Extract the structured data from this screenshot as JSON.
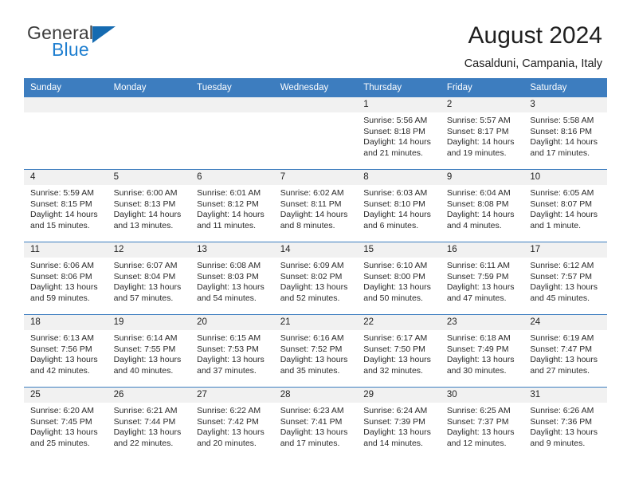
{
  "brand": {
    "general": "General",
    "blue": "Blue",
    "accent_color": "#1f7fd0",
    "flag_color": "#156bb1"
  },
  "header": {
    "title": "August 2024",
    "subtitle": "Casalduni, Campania, Italy"
  },
  "calendar": {
    "header_bg": "#3d7dbf",
    "daynum_bg": "#f1f1f1",
    "weekdays": [
      "Sunday",
      "Monday",
      "Tuesday",
      "Wednesday",
      "Thursday",
      "Friday",
      "Saturday"
    ],
    "weeks": [
      [
        {
          "day": "",
          "empty": true
        },
        {
          "day": "",
          "empty": true
        },
        {
          "day": "",
          "empty": true
        },
        {
          "day": "",
          "empty": true
        },
        {
          "day": "1",
          "sunrise": "Sunrise: 5:56 AM",
          "sunset": "Sunset: 8:18 PM",
          "daylight": "Daylight: 14 hours and 21 minutes."
        },
        {
          "day": "2",
          "sunrise": "Sunrise: 5:57 AM",
          "sunset": "Sunset: 8:17 PM",
          "daylight": "Daylight: 14 hours and 19 minutes."
        },
        {
          "day": "3",
          "sunrise": "Sunrise: 5:58 AM",
          "sunset": "Sunset: 8:16 PM",
          "daylight": "Daylight: 14 hours and 17 minutes."
        }
      ],
      [
        {
          "day": "4",
          "sunrise": "Sunrise: 5:59 AM",
          "sunset": "Sunset: 8:15 PM",
          "daylight": "Daylight: 14 hours and 15 minutes."
        },
        {
          "day": "5",
          "sunrise": "Sunrise: 6:00 AM",
          "sunset": "Sunset: 8:13 PM",
          "daylight": "Daylight: 14 hours and 13 minutes."
        },
        {
          "day": "6",
          "sunrise": "Sunrise: 6:01 AM",
          "sunset": "Sunset: 8:12 PM",
          "daylight": "Daylight: 14 hours and 11 minutes."
        },
        {
          "day": "7",
          "sunrise": "Sunrise: 6:02 AM",
          "sunset": "Sunset: 8:11 PM",
          "daylight": "Daylight: 14 hours and 8 minutes."
        },
        {
          "day": "8",
          "sunrise": "Sunrise: 6:03 AM",
          "sunset": "Sunset: 8:10 PM",
          "daylight": "Daylight: 14 hours and 6 minutes."
        },
        {
          "day": "9",
          "sunrise": "Sunrise: 6:04 AM",
          "sunset": "Sunset: 8:08 PM",
          "daylight": "Daylight: 14 hours and 4 minutes."
        },
        {
          "day": "10",
          "sunrise": "Sunrise: 6:05 AM",
          "sunset": "Sunset: 8:07 PM",
          "daylight": "Daylight: 14 hours and 1 minute."
        }
      ],
      [
        {
          "day": "11",
          "sunrise": "Sunrise: 6:06 AM",
          "sunset": "Sunset: 8:06 PM",
          "daylight": "Daylight: 13 hours and 59 minutes."
        },
        {
          "day": "12",
          "sunrise": "Sunrise: 6:07 AM",
          "sunset": "Sunset: 8:04 PM",
          "daylight": "Daylight: 13 hours and 57 minutes."
        },
        {
          "day": "13",
          "sunrise": "Sunrise: 6:08 AM",
          "sunset": "Sunset: 8:03 PM",
          "daylight": "Daylight: 13 hours and 54 minutes."
        },
        {
          "day": "14",
          "sunrise": "Sunrise: 6:09 AM",
          "sunset": "Sunset: 8:02 PM",
          "daylight": "Daylight: 13 hours and 52 minutes."
        },
        {
          "day": "15",
          "sunrise": "Sunrise: 6:10 AM",
          "sunset": "Sunset: 8:00 PM",
          "daylight": "Daylight: 13 hours and 50 minutes."
        },
        {
          "day": "16",
          "sunrise": "Sunrise: 6:11 AM",
          "sunset": "Sunset: 7:59 PM",
          "daylight": "Daylight: 13 hours and 47 minutes."
        },
        {
          "day": "17",
          "sunrise": "Sunrise: 6:12 AM",
          "sunset": "Sunset: 7:57 PM",
          "daylight": "Daylight: 13 hours and 45 minutes."
        }
      ],
      [
        {
          "day": "18",
          "sunrise": "Sunrise: 6:13 AM",
          "sunset": "Sunset: 7:56 PM",
          "daylight": "Daylight: 13 hours and 42 minutes."
        },
        {
          "day": "19",
          "sunrise": "Sunrise: 6:14 AM",
          "sunset": "Sunset: 7:55 PM",
          "daylight": "Daylight: 13 hours and 40 minutes."
        },
        {
          "day": "20",
          "sunrise": "Sunrise: 6:15 AM",
          "sunset": "Sunset: 7:53 PM",
          "daylight": "Daylight: 13 hours and 37 minutes."
        },
        {
          "day": "21",
          "sunrise": "Sunrise: 6:16 AM",
          "sunset": "Sunset: 7:52 PM",
          "daylight": "Daylight: 13 hours and 35 minutes."
        },
        {
          "day": "22",
          "sunrise": "Sunrise: 6:17 AM",
          "sunset": "Sunset: 7:50 PM",
          "daylight": "Daylight: 13 hours and 32 minutes."
        },
        {
          "day": "23",
          "sunrise": "Sunrise: 6:18 AM",
          "sunset": "Sunset: 7:49 PM",
          "daylight": "Daylight: 13 hours and 30 minutes."
        },
        {
          "day": "24",
          "sunrise": "Sunrise: 6:19 AM",
          "sunset": "Sunset: 7:47 PM",
          "daylight": "Daylight: 13 hours and 27 minutes."
        }
      ],
      [
        {
          "day": "25",
          "sunrise": "Sunrise: 6:20 AM",
          "sunset": "Sunset: 7:45 PM",
          "daylight": "Daylight: 13 hours and 25 minutes."
        },
        {
          "day": "26",
          "sunrise": "Sunrise: 6:21 AM",
          "sunset": "Sunset: 7:44 PM",
          "daylight": "Daylight: 13 hours and 22 minutes."
        },
        {
          "day": "27",
          "sunrise": "Sunrise: 6:22 AM",
          "sunset": "Sunset: 7:42 PM",
          "daylight": "Daylight: 13 hours and 20 minutes."
        },
        {
          "day": "28",
          "sunrise": "Sunrise: 6:23 AM",
          "sunset": "Sunset: 7:41 PM",
          "daylight": "Daylight: 13 hours and 17 minutes."
        },
        {
          "day": "29",
          "sunrise": "Sunrise: 6:24 AM",
          "sunset": "Sunset: 7:39 PM",
          "daylight": "Daylight: 13 hours and 14 minutes."
        },
        {
          "day": "30",
          "sunrise": "Sunrise: 6:25 AM",
          "sunset": "Sunset: 7:37 PM",
          "daylight": "Daylight: 13 hours and 12 minutes."
        },
        {
          "day": "31",
          "sunrise": "Sunrise: 6:26 AM",
          "sunset": "Sunset: 7:36 PM",
          "daylight": "Daylight: 13 hours and 9 minutes."
        }
      ]
    ]
  }
}
